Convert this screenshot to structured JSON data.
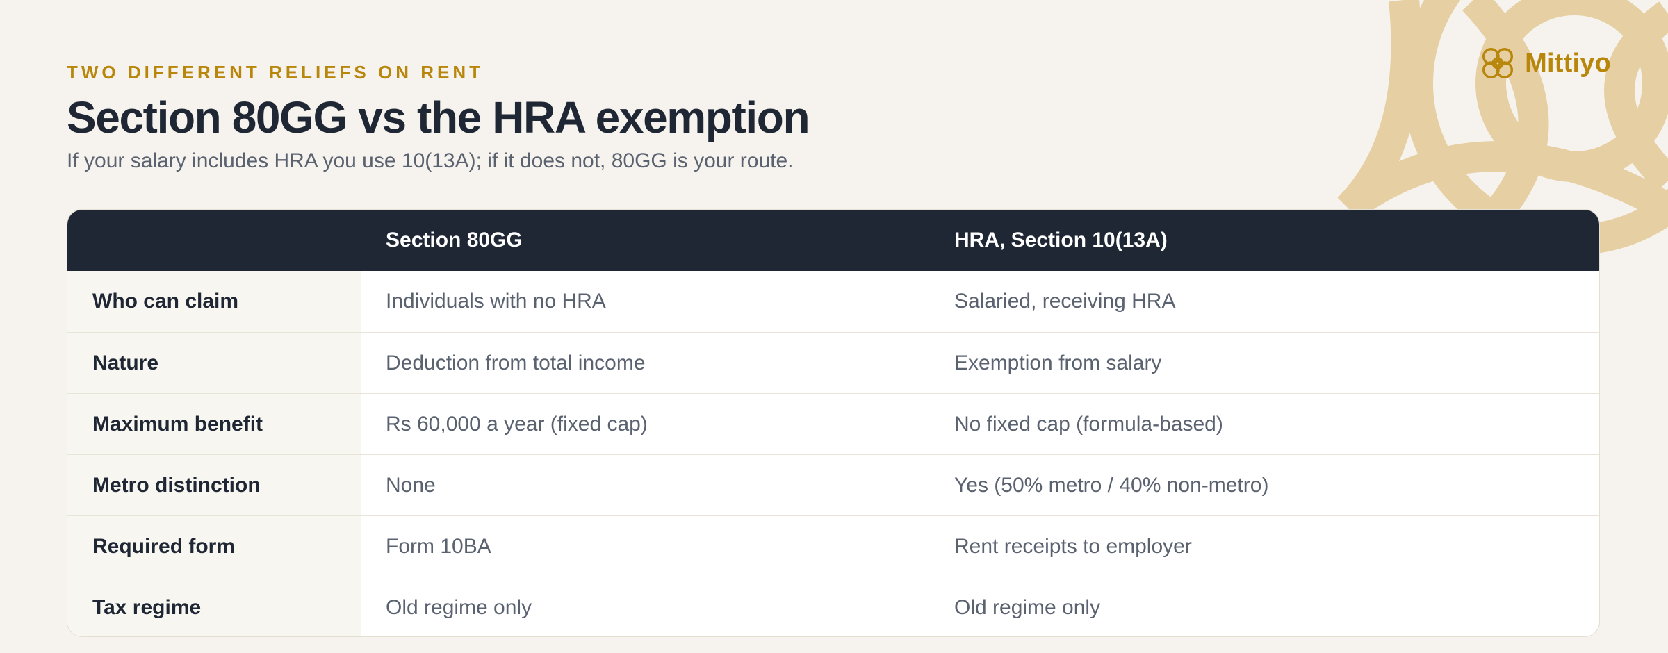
{
  "brand": {
    "name": "Mittiyo",
    "accent_color": "#b8860b",
    "icon": "knot-logo-icon"
  },
  "header": {
    "eyebrow": "TWO DIFFERENT RELIEFS ON RENT",
    "title": "Section 80GG vs the HRA exemption",
    "subtitle": "If your salary includes HRA you use 10(13A); if it does not, 80GG is your route."
  },
  "table": {
    "columns": [
      "",
      "Section 80GG",
      "HRA, Section 10(13A)"
    ],
    "rows": [
      {
        "label": "Who can claim",
        "a": "Individuals with no HRA",
        "b": "Salaried, receiving HRA"
      },
      {
        "label": "Nature",
        "a": "Deduction from total income",
        "b": "Exemption from salary"
      },
      {
        "label": "Maximum benefit",
        "a": "Rs 60,000 a year (fixed cap)",
        "b": "No fixed cap (formula-based)"
      },
      {
        "label": "Metro distinction",
        "a": "None",
        "b": "Yes (50% metro / 40% non-metro)"
      },
      {
        "label": "Required form",
        "a": "Form 10BA",
        "b": "Rent receipts to employer"
      },
      {
        "label": "Tax regime",
        "a": "Old regime only",
        "b": "Old regime only"
      }
    ]
  },
  "colors": {
    "background": "#f6f3ee",
    "header_row": "#1e2733",
    "decor": "#e6cfa0"
  }
}
